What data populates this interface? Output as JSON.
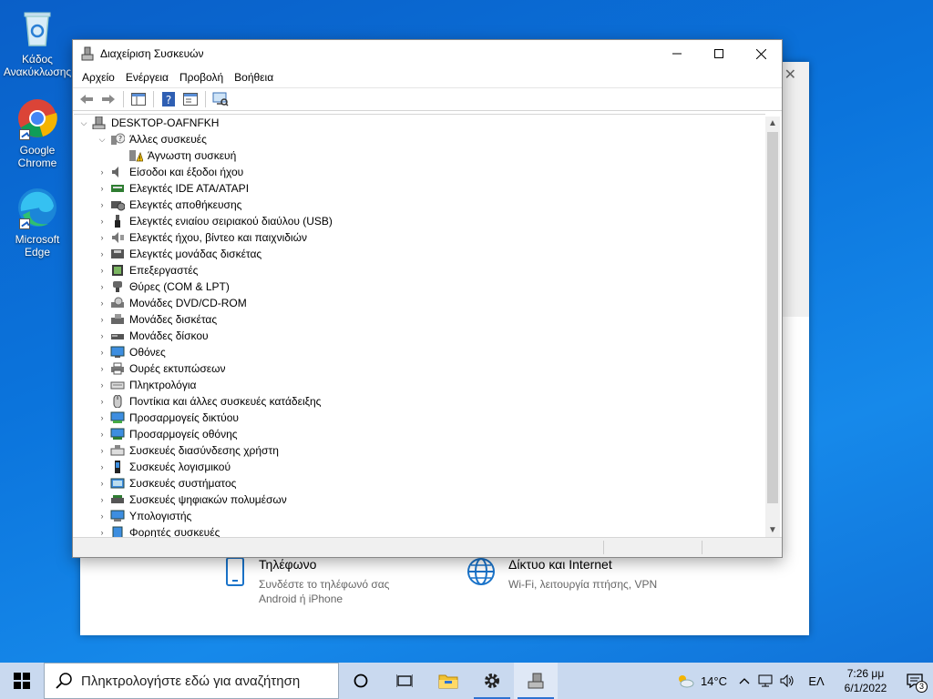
{
  "desktop": {
    "icons": [
      {
        "label": "Κάδος Ανακύκλωσης"
      },
      {
        "label": "Google Chrome"
      },
      {
        "label": "Microsoft Edge"
      }
    ]
  },
  "settings_window": {
    "phone": {
      "title": "Τηλέφωνο",
      "subtitle": "Συνδέστε το τηλέφωνό σας Android ή iPhone"
    },
    "network": {
      "title": "Δίκτυο και Internet",
      "subtitle": "Wi-Fi, λειτουργία πτήσης, VPN"
    }
  },
  "device_manager": {
    "title": "Διαχείριση Συσκευών",
    "menu": [
      "Αρχείο",
      "Ενέργεια",
      "Προβολή",
      "Βοήθεια"
    ],
    "root": "DESKTOP-OAFNFKH",
    "other_devices": {
      "label": "Άλλες συσκευές",
      "children": [
        "Άγνωστη συσκευή"
      ]
    },
    "categories": [
      {
        "label": "Είσοδοι και έξοδοι ήχου",
        "icon": "speaker-icon"
      },
      {
        "label": "Ελεγκτές IDE ATA/ATAPI",
        "icon": "ide-controller-icon"
      },
      {
        "label": "Ελεγκτές αποθήκευσης",
        "icon": "storage-controller-icon"
      },
      {
        "label": "Ελεγκτές ενιαίου σειριακού διαύλου (USB)",
        "icon": "usb-icon"
      },
      {
        "label": "Ελεγκτές ήχου, βίντεο και παιχνιδιών",
        "icon": "sound-icon"
      },
      {
        "label": "Ελεγκτές μονάδας δισκέτας",
        "icon": "floppy-controller-icon"
      },
      {
        "label": "Επεξεργαστές",
        "icon": "processor-icon"
      },
      {
        "label": "Θύρες (COM & LPT)",
        "icon": "port-icon"
      },
      {
        "label": "Μονάδες DVD/CD-ROM",
        "icon": "dvd-icon"
      },
      {
        "label": "Μονάδες δισκέτας",
        "icon": "floppy-drive-icon"
      },
      {
        "label": "Μονάδες δίσκου",
        "icon": "disk-drive-icon"
      },
      {
        "label": "Οθόνες",
        "icon": "monitor-icon"
      },
      {
        "label": "Ουρές εκτυπώσεων",
        "icon": "printer-icon"
      },
      {
        "label": "Πληκτρολόγια",
        "icon": "keyboard-icon"
      },
      {
        "label": "Ποντίκια και άλλες συσκευές κατάδειξης",
        "icon": "mouse-icon"
      },
      {
        "label": "Προσαρμογείς δικτύου",
        "icon": "network-adapter-icon"
      },
      {
        "label": "Προσαρμογείς οθόνης",
        "icon": "display-adapter-icon"
      },
      {
        "label": "Συσκευές διασύνδεσης χρήστη",
        "icon": "hid-icon"
      },
      {
        "label": "Συσκευές λογισμικού",
        "icon": "software-device-icon"
      },
      {
        "label": "Συσκευές συστήματος",
        "icon": "system-device-icon"
      },
      {
        "label": "Συσκευές ψηφιακών πολυμέσων",
        "icon": "media-device-icon"
      },
      {
        "label": "Υπολογιστής",
        "icon": "computer-icon"
      },
      {
        "label": "Φορητές συσκευές",
        "icon": "portable-device-icon"
      }
    ]
  },
  "taskbar": {
    "search_placeholder": "Πληκτρολογήστε εδώ για αναζήτηση",
    "weather": "14°C",
    "language": "ΕΛ",
    "time": "7:26 μμ",
    "date": "6/1/2022",
    "notifications": "3"
  }
}
